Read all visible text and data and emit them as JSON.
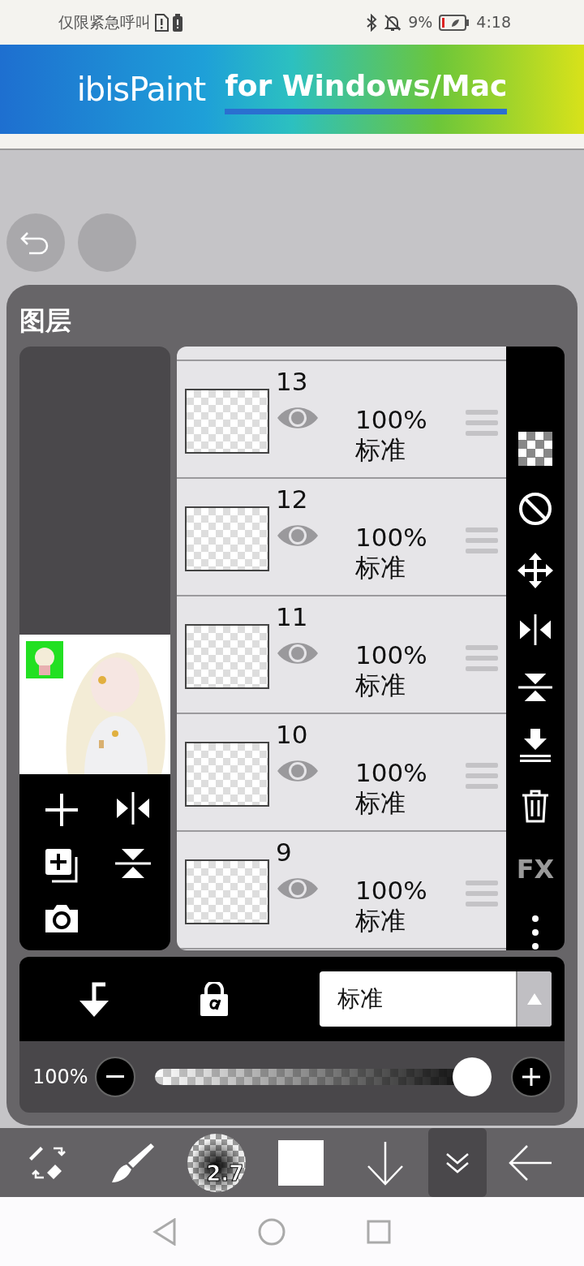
{
  "status_bar": {
    "carrier": "仅限紧急呼叫",
    "battery": "9%",
    "time": "4:18"
  },
  "banner": {
    "brand": "ibisPaint",
    "tagline": "for Windows/Mac"
  },
  "panel": {
    "title": "图层"
  },
  "layers": [
    {
      "number": "13",
      "opacity": "100%",
      "blend": "标准",
      "visible": true
    },
    {
      "number": "12",
      "opacity": "100%",
      "blend": "标准",
      "visible": true
    },
    {
      "number": "11",
      "opacity": "100%",
      "blend": "标准",
      "visible": true
    },
    {
      "number": "10",
      "opacity": "100%",
      "blend": "标准",
      "visible": true
    },
    {
      "number": "9",
      "opacity": "100%",
      "blend": "标准",
      "visible": true
    }
  ],
  "side_tools": {
    "fx_label": "FX"
  },
  "blend_mode": {
    "value": "标准"
  },
  "opacity": {
    "reading": "100%",
    "level": 1.0
  },
  "toolbar": {
    "brush_size": "2.7",
    "tools": [
      {
        "kind": "swap",
        "selected": false
      },
      {
        "kind": "brush",
        "selected": false
      },
      {
        "kind": "size",
        "selected": false
      },
      {
        "kind": "color",
        "selected": false
      },
      {
        "kind": "down",
        "selected": false
      },
      {
        "kind": "collapse",
        "selected": true
      },
      {
        "kind": "back",
        "selected": false
      }
    ]
  }
}
